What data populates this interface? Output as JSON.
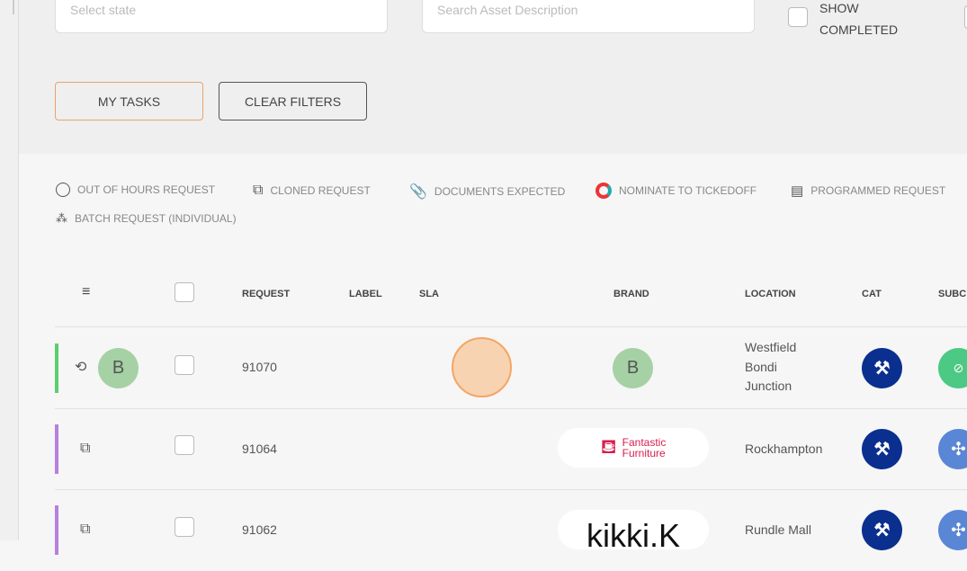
{
  "filters": {
    "state_placeholder": "Select state",
    "asset_placeholder": "Search Asset Description",
    "show_completed": "SHOW COMPLETED"
  },
  "buttons": {
    "my_tasks": "MY TASKS",
    "clear_filters": "CLEAR FILTERS"
  },
  "legend": [
    "OUT OF HOURS REQUEST",
    "CLONED REQUEST",
    "DOCUMENTS EXPECTED",
    "NOMINATE TO TICKEDOFF",
    "PROGRAMMED REQUEST",
    "BATCH REQUEST (INDIVIDUAL)"
  ],
  "columns": {
    "request": "REQUEST",
    "label": "LABEL",
    "sla": "SLA",
    "brand": "BRAND",
    "location": "LOCATION",
    "cat": "CAT",
    "subcat": "SUBC"
  },
  "rows": [
    {
      "request": "91070",
      "avatar": "B",
      "brand_initial": "B",
      "location": "Westfield Bondi Junction",
      "color": "#5ccf6c"
    },
    {
      "request": "91064",
      "brand_text_1": "Fantastic",
      "brand_text_2": "Furniture",
      "location": "Rockhampton",
      "color": "#b77fe0"
    },
    {
      "request": "91062",
      "brand_logo": "kikki.K",
      "location": "Rundle Mall",
      "color": "#b77fe0"
    }
  ]
}
